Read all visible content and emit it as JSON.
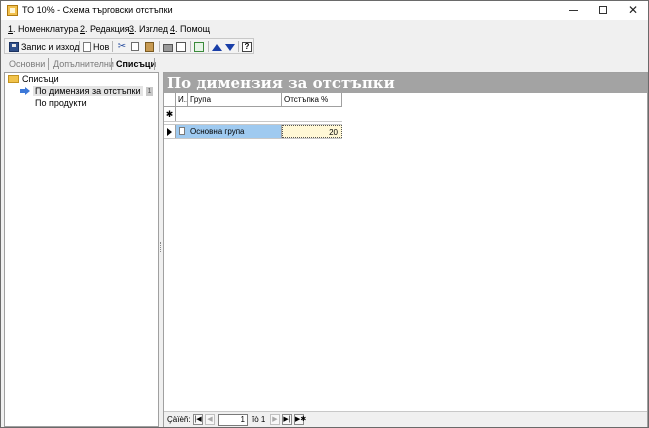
{
  "window": {
    "title": "ТО 10% - Схема търговски отстъпки",
    "minimize_icon": "minimize-icon",
    "maximize_icon": "maximize-icon",
    "close_icon": "close-icon"
  },
  "menu": {
    "items": [
      {
        "num": "1",
        "rest": ". Номенклатура"
      },
      {
        "num": "2",
        "rest": ". Редакция"
      },
      {
        "num": "3",
        "rest": ". Изглед"
      },
      {
        "num": "4",
        "rest": ". Помощ"
      }
    ]
  },
  "toolbar": {
    "save_exit_label": "Запис и изход",
    "new_label": "Нов"
  },
  "tabs": {
    "basic": "Основни",
    "additional": "Допълнителни",
    "lists": "Списъци",
    "active": "lists"
  },
  "tree": {
    "root": "Списъци",
    "items": [
      {
        "label": "По димензия за отстъпки",
        "badge": "1",
        "selected": true
      },
      {
        "label": "По продукти",
        "selected": false
      }
    ]
  },
  "panel": {
    "title": "По димензия за отстъпки"
  },
  "grid": {
    "columns": [
      "И...",
      "Група",
      "Отстъпка %"
    ],
    "new_row_marker": "✱",
    "rows": [
      {
        "group": "Основна група",
        "discount": "20"
      }
    ]
  },
  "navigator": {
    "label": "Çàïèñ:",
    "current": "1",
    "of_text": "îò 1"
  }
}
